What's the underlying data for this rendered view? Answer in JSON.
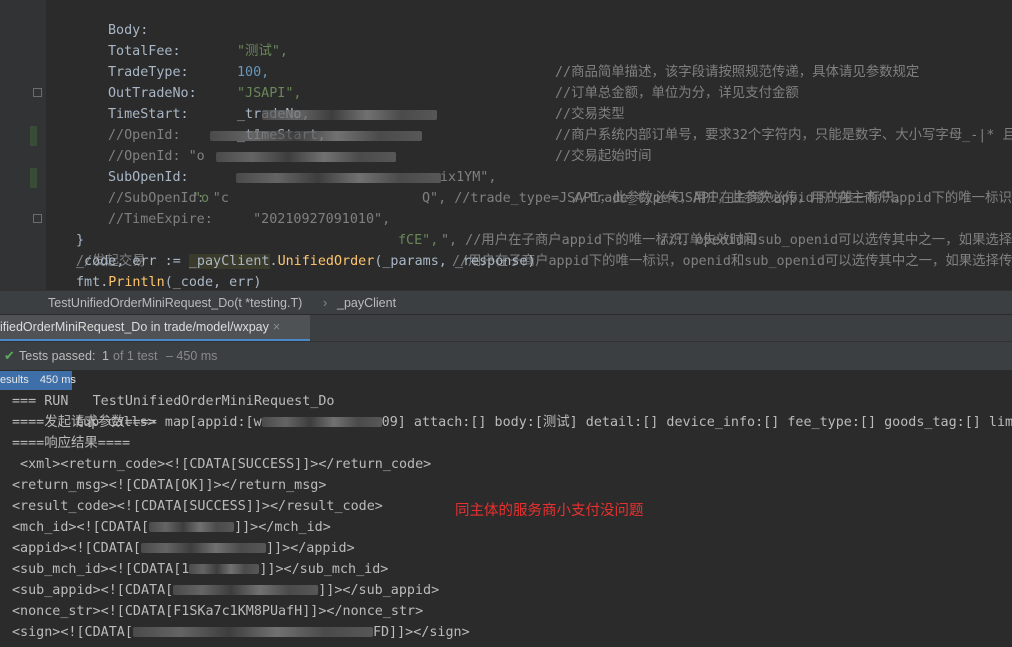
{
  "editor": {
    "lines": [
      {
        "field": "Body:",
        "value": "\"测试\",",
        "comment": "//商品简单描述，该字段请按照规范传递，具体请见参数规定"
      },
      {
        "field": "TotalFee:",
        "value": "100,",
        "comment": "//订单总金额，单位为分，详见支付金额"
      },
      {
        "field": "TradeType:",
        "value": "\"JSAPI\",",
        "comment": "//交易类型"
      },
      {
        "field": "OutTradeNo:",
        "value": "_tradeNo,",
        "comment": "//商户系统内部订单号，要求32个字符内，只能是数字、大小写字母_-|* 且在"
      },
      {
        "field": "TimeStart:",
        "value": "_timeStart,",
        "comment": "//交易起始时间"
      },
      {
        "line": "//OpenId:         \"",
        "tail": "ix1YM\",",
        "comment": "//trade_type=JSAPI，此参数必传，用户在主商户appid下的唯一标识。"
      },
      {
        "line": "//OpenId: \"o",
        "tail": "Q\", //trade_type=JSAPI，此参数必传，用户在主商户appid下的唯一标识。"
      },
      {
        "field": "SubOpenId:",
        "value_prefix": "\"o",
        "value_tail": "fCE\",",
        "comment": "//用户在子商户appid下的唯一标识，openid和sub_openid可以选传其中之一，如果选择传su"
      },
      {
        "line": "//SubOpenId: \"c",
        "tail": "\", //用户在子商户appid下的唯一标识，openid和sub_openid可以选传其中之一，如果选择传"
      },
      {
        "line": "//TimeExpire:     \"20210927091010\",",
        "comment": "//订单失效时间"
      },
      {
        "line": "}"
      },
      {
        "line": "//发起交易"
      },
      {
        "code": [
          "_code, err := ",
          "_payClient",
          ".",
          "UnifiedOrder",
          "(_params, _response)"
        ]
      },
      {
        "code": [
          "fmt",
          ".",
          "Println",
          "(_code, err)"
        ]
      }
    ]
  },
  "breadcrumb": {
    "function": "TestUnifiedOrderMiniRequest_Do(t *testing.T)",
    "symbol": "_payClient"
  },
  "run_tab": {
    "label": "ifiedOrderMiniRequest_Do in trade/model/wxpay",
    "close": "×"
  },
  "status": {
    "passed_label": "Tests passed:",
    "passed_count": "1",
    "total": "of 1 test",
    "duration": "– 450 ms"
  },
  "console": {
    "badge_label": "esults",
    "badge_time": "450 ms",
    "header": "tup calls>",
    "lines": [
      "=== RUN   TestUnifiedOrderMiniRequest_Do",
      "====发起请求参数==== map[appid:[w",
      "09] attach:[] body:[测试] detail:[] device_info:[] fee_type:[] goods_tag:[] limi",
      "====响应结果====",
      " <xml><return_code><![CDATA[SUCCESS]]></return_code>",
      "<return_msg><![CDATA[OK]]></return_msg>",
      "<result_code><![CDATA[SUCCESS]]></result_code>",
      "<mch_id><![CDATA[",
      "]]></mch_id>",
      "<appid><![CDATA[",
      "]]></appid>",
      "<sub_mch_id><![CDATA[1",
      "]]></sub_mch_id>",
      "<sub_appid><![CDATA[",
      "]]></sub_appid>",
      "<nonce_str><![CDATA[F1SKa7c1KM8PUafH]]></nonce_str>",
      "<sign><![CDATA[",
      "FD]]></sign>"
    ]
  },
  "annotation": "同主体的服务商小支付没问题",
  "colors": {
    "background": "#2b2b2b",
    "string": "#6a8759",
    "number": "#6897bb",
    "comment": "#808080",
    "function": "#ffc66d",
    "pass": "#5fa85f",
    "annotation": "#e8312f"
  }
}
